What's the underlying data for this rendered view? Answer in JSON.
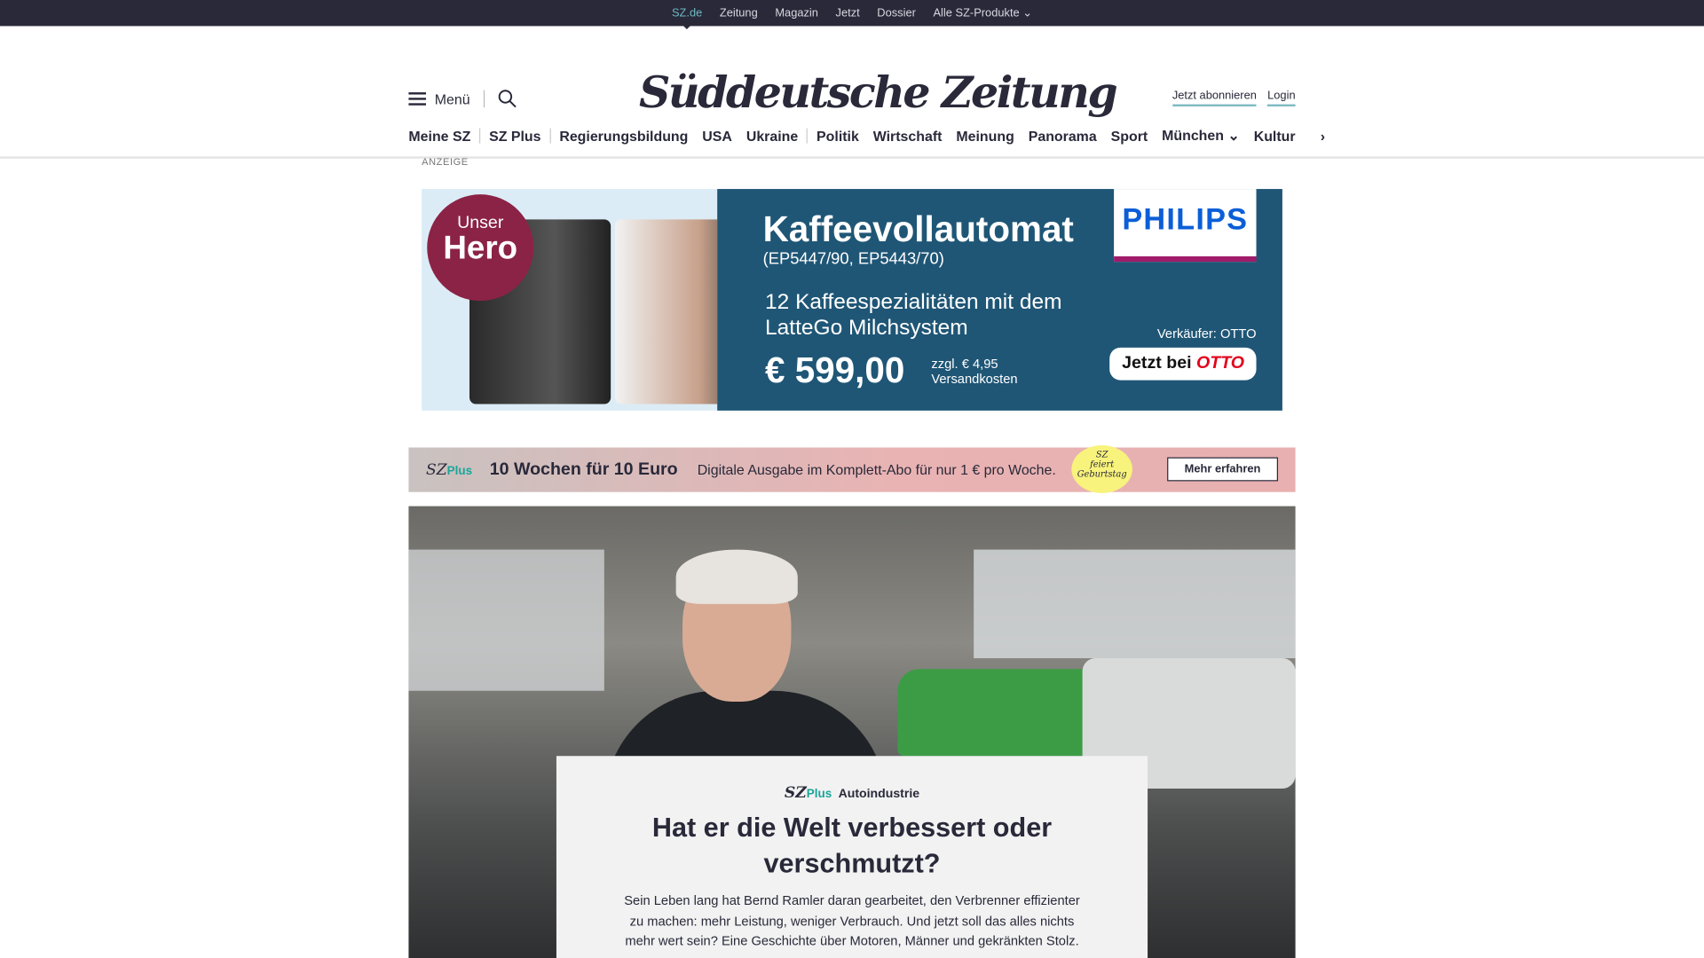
{
  "topbar": {
    "items": [
      "SZ.de",
      "Zeitung",
      "Magazin",
      "Jetzt",
      "Dossier",
      "Alle SZ-Produkte"
    ]
  },
  "header": {
    "menu": "Menü",
    "logo": "Süddeutsche Zeitung",
    "subscribe": "Jetzt abonnieren",
    "login": "Login"
  },
  "nav": {
    "items": [
      "Meine SZ",
      "SZ Plus",
      "Regierungsbildung",
      "USA",
      "Ukraine",
      "Politik",
      "Wirtschaft",
      "Meinung",
      "Panorama",
      "Sport",
      "München",
      "Kultur"
    ]
  },
  "ad": {
    "label": "ANZEIGE",
    "badge_top": "Unser",
    "badge_bottom": "Hero",
    "title": "Kaffeevollautomat",
    "models": "(EP5447/90, EP5443/70)",
    "desc": "12 Kaffeespezialitäten mit dem LatteGo Milchsystem",
    "price": "€ 599,00",
    "shipping": "zzgl. € 4,95 Versandkosten",
    "brand": "PHILIPS",
    "seller": "Verkäufer: OTTO",
    "cta": "Jetzt bei",
    "cta_brand": "OTTO"
  },
  "promo": {
    "logo": "SZ",
    "logo_plus": "Plus",
    "headline": "10 Wochen für 10 Euro",
    "desc": "Digitale Ausgabe im Komplett-Abo für nur 1 € pro Woche.",
    "badge": "feiert Geburtstag",
    "button": "Mehr erfahren"
  },
  "article": {
    "logo": "SZ",
    "logo_plus": "Plus",
    "category": "Autoindustrie",
    "title": "Hat er die Welt verbessert oder verschmutzt?",
    "teaser": "Sein Leben lang hat Bernd Ramler daran gearbeitet, den Verbrenner effizienter zu machen: mehr Leistung, weniger Verbrauch. Und jetzt soll das alles nichts mehr wert sein? Eine Geschichte über Motoren, Männer und gekränkten Stolz."
  }
}
